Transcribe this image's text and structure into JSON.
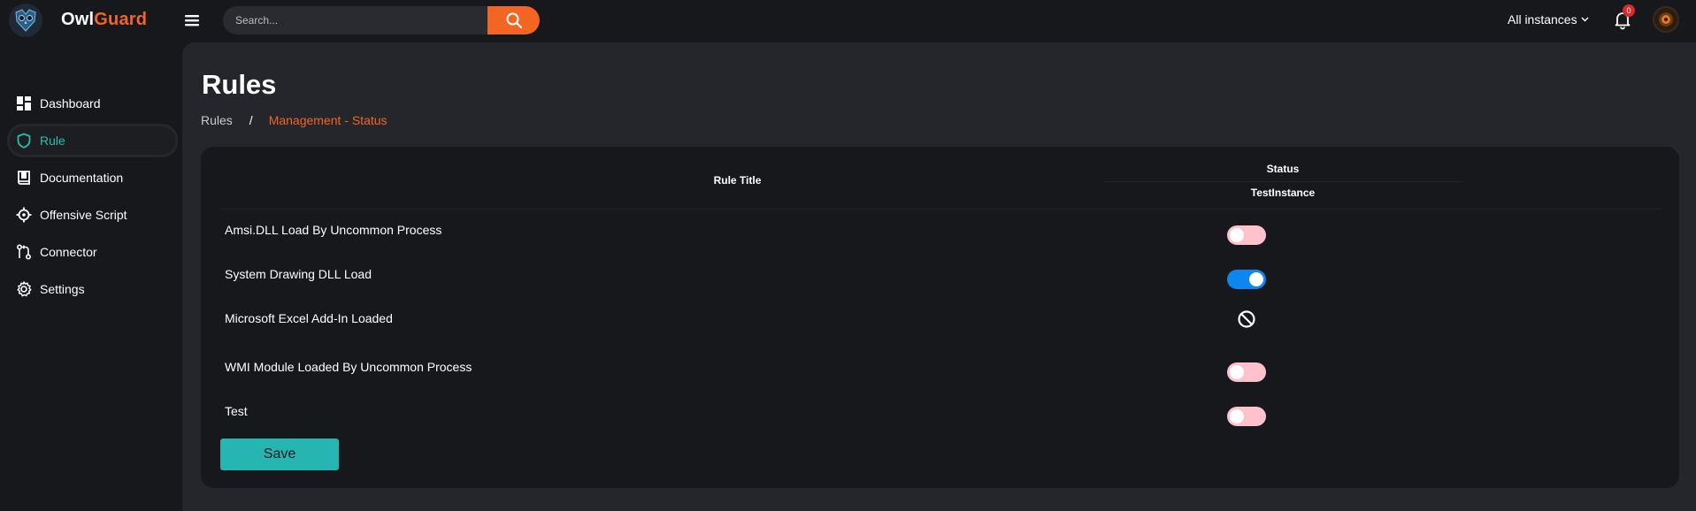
{
  "app": {
    "brand_part1": "Owl",
    "brand_part2": "Guard",
    "accent_color": "#f26522",
    "logo_icon": "owl-logo-icon"
  },
  "search": {
    "placeholder": "Search...",
    "value": "",
    "button_icon": "search-icon"
  },
  "header": {
    "instances_label": "All instances",
    "notification_count": "0"
  },
  "sidebar": {
    "items": [
      {
        "label": "Dashboard",
        "icon": "dashboard-icon",
        "active": false
      },
      {
        "label": "Rule",
        "icon": "shield-icon",
        "active": true
      },
      {
        "label": "Documentation",
        "icon": "book-icon",
        "active": false
      },
      {
        "label": "Offensive Script",
        "icon": "crosshair-icon",
        "active": false
      },
      {
        "label": "Connector",
        "icon": "connector-icon",
        "active": false
      },
      {
        "label": "Settings",
        "icon": "gear-icon",
        "active": false
      }
    ]
  },
  "page": {
    "title": "Rules",
    "breadcrumb_root": "Rules",
    "breadcrumb_sep": "/",
    "breadcrumb_current": "Management - Status"
  },
  "table": {
    "col_title": "Rule Title",
    "col_status": "Status",
    "col_instance": "TestInstance",
    "rows": [
      {
        "title": "Amsi.DLL Load By Uncommon Process",
        "status": "off"
      },
      {
        "title": "System Drawing DLL Load",
        "status": "on"
      },
      {
        "title": "Microsoft Excel Add-In Loaded",
        "status": "unavailable"
      },
      {
        "title": "WMI Module Loaded By Uncommon Process",
        "status": "off"
      },
      {
        "title": "Test",
        "status": "off"
      }
    ],
    "toggle_on_color": "#0d86f0",
    "toggle_off_color": "#ffc2cc"
  },
  "actions": {
    "save_label": "Save",
    "save_color": "#26b5b0"
  }
}
